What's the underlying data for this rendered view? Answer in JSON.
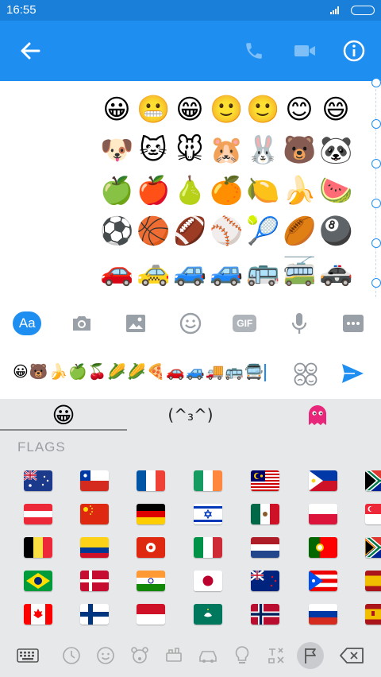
{
  "status_bar": {
    "time": "16:55"
  },
  "colors": {
    "accent": "#1f8ef1",
    "appbar": "#1f8ef1",
    "statusbar": "#1a7fd9",
    "keyboard_bg": "#e7e8ea"
  },
  "header": {
    "back_icon": "arrow-left-icon",
    "call_icon": "phone-icon",
    "video_icon": "video-camera-icon",
    "info_icon": "info-icon"
  },
  "chat": {
    "emoji_rows": [
      [
        "😀",
        "😬",
        "😁",
        "🙂",
        "🙂",
        "😊",
        "😄"
      ],
      [
        "🐶",
        "🐱",
        "🐭",
        "🐹",
        "🐰",
        "🐻",
        "🐼"
      ],
      [
        "🍏",
        "🍎",
        "🍐",
        "🍊",
        "🍋",
        "🍌",
        "🍉"
      ],
      [
        "⚽",
        "🏀",
        "🏈",
        "⚾",
        "🎾",
        "🏉",
        "🎱"
      ],
      [
        "🚗",
        "🚕",
        "🚙",
        "🚙",
        "🚌",
        "🚎",
        "🚓"
      ]
    ]
  },
  "toolbar": {
    "text_label": "Aa",
    "gif_label": "GIF",
    "items": [
      "camera-icon",
      "image-icon",
      "emoji-icon",
      "gif-icon",
      "microphone-icon",
      "more-icon"
    ]
  },
  "compose": {
    "message": "😀🐻🍌🍏🍒🌽🌽🍕🚗🚙🚚🚌🚍"
  },
  "keyboard": {
    "tabs": {
      "emoji": "😀",
      "kaomoji": "(^₃^)",
      "ghost": "ghost-icon"
    },
    "section_title": "FLAGS",
    "flag_rows": [
      [
        "au",
        "cl",
        "fr",
        "ie",
        "my",
        "ph",
        "za"
      ],
      [
        "at",
        "cn",
        "de",
        "il",
        "mx",
        "pl",
        "sg"
      ],
      [
        "be",
        "co",
        "hk",
        "it",
        "nl",
        "pt",
        "za"
      ],
      [
        "br",
        "dk",
        "in",
        "jp",
        "nz",
        "pr",
        "es"
      ],
      [
        "ca",
        "fi",
        "id",
        "mo",
        "no",
        "ru",
        "es"
      ]
    ],
    "bottom_icons": [
      "keyboard-icon",
      "clock-icon",
      "smiley-icon",
      "animal-icon",
      "food-icon",
      "car-icon",
      "lightbulb-icon",
      "symbols-icon",
      "flag-icon",
      "backspace-icon"
    ]
  }
}
